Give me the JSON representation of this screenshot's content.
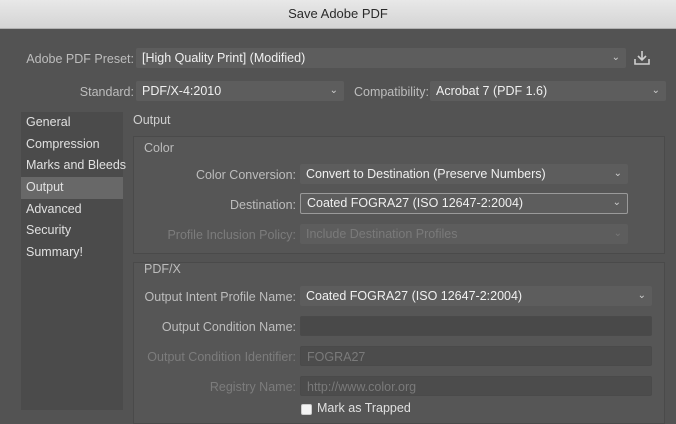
{
  "window": {
    "title": "Save Adobe PDF"
  },
  "preset": {
    "label": "Adobe PDF Preset:",
    "value": "[High Quality Print] (Modified)",
    "chevron_icon": "chevron-down-icon",
    "save_icon": "save-preset-icon"
  },
  "standard": {
    "label": "Standard:",
    "value": "PDF/X-4:2010"
  },
  "compatibility": {
    "label": "Compatibility:",
    "value": "Acrobat 7 (PDF 1.6)"
  },
  "sidebar": {
    "items": [
      {
        "label": "General"
      },
      {
        "label": "Compression"
      },
      {
        "label": "Marks and Bleeds"
      },
      {
        "label": "Output"
      },
      {
        "label": "Advanced"
      },
      {
        "label": "Security"
      },
      {
        "label": "Summary!"
      }
    ],
    "selected": "Output"
  },
  "main": {
    "section_title": "Output",
    "color_group": {
      "title": "Color",
      "conversion": {
        "label": "Color Conversion:",
        "value": "Convert to Destination (Preserve Numbers)"
      },
      "destination": {
        "label": "Destination:",
        "value": "Coated FOGRA27 (ISO 12647-2:2004)"
      },
      "inclusion": {
        "label": "Profile Inclusion Policy:",
        "value": "Include Destination Profiles"
      }
    },
    "pdfx_group": {
      "title": "PDF/X",
      "intent_profile": {
        "label": "Output Intent Profile Name:",
        "value": "Coated FOGRA27 (ISO 12647-2:2004)"
      },
      "condition_name": {
        "label": "Output Condition Name:",
        "value": ""
      },
      "condition_identifier": {
        "label": "Output Condition Identifier:",
        "value": "FOGRA27"
      },
      "registry": {
        "label": "Registry Name:",
        "value": "http://www.color.org"
      },
      "trapped": {
        "label": "Mark as Trapped",
        "checked": false
      }
    }
  }
}
